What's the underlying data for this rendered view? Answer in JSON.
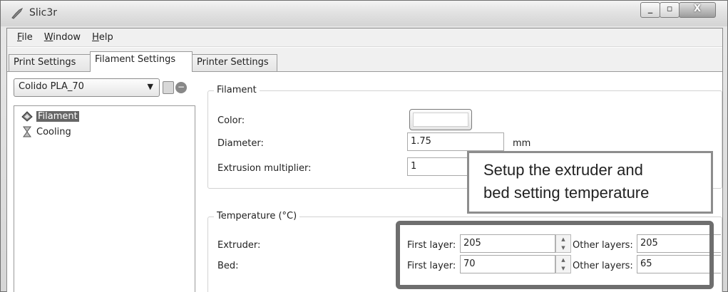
{
  "window": {
    "title": "Slic3r"
  },
  "menu": [
    {
      "label": "File",
      "mnemonic": "F",
      "rest": "ile"
    },
    {
      "label": "Window",
      "mnemonic": "W",
      "rest": "indow"
    },
    {
      "label": "Help",
      "mnemonic": "H",
      "rest": "elp"
    }
  ],
  "tabs": [
    {
      "label": "Print Settings",
      "active": false
    },
    {
      "label": "Filament Settings",
      "active": true
    },
    {
      "label": "Printer Settings",
      "active": false
    }
  ],
  "preset": {
    "selected": "Colido PLA_70"
  },
  "tree": [
    {
      "label": "Filament",
      "selected": true,
      "icon": "filament-spool-icon"
    },
    {
      "label": "Cooling",
      "selected": false,
      "icon": "hourglass-icon"
    }
  ],
  "filament_group": {
    "title": "Filament",
    "color_label": "Color:",
    "color_value": "#ffffff",
    "diameter_label": "Diameter:",
    "diameter_value": "1.75",
    "diameter_unit": "mm",
    "extrusion_label": "Extrusion multiplier:",
    "extrusion_value": "1"
  },
  "temperature_group": {
    "title": "Temperature (°C)",
    "extruder_label": "Extruder:",
    "bed_label": "Bed:",
    "first_layer_label": "First layer:",
    "other_layers_label": "Other layers:",
    "extruder_first": "205",
    "extruder_other": "205",
    "bed_first": "70",
    "bed_other": "65"
  },
  "callout": {
    "line1": "Setup the extruder and",
    "line2": "bed setting temperature"
  }
}
